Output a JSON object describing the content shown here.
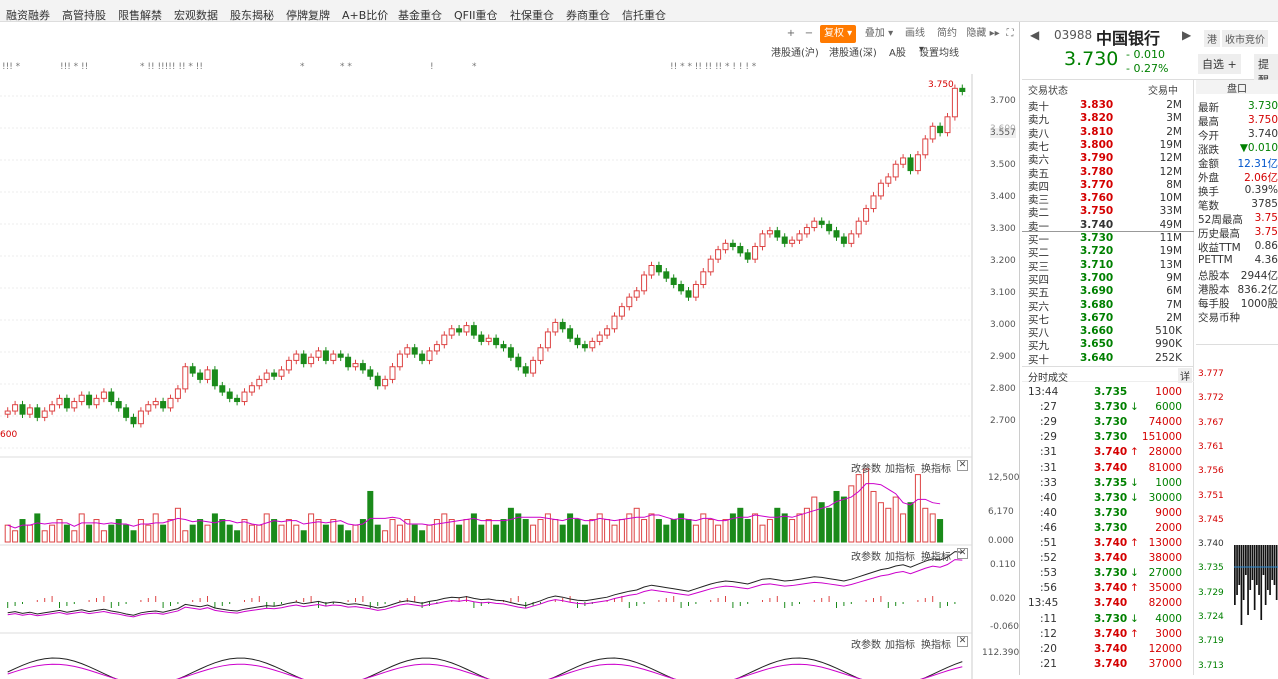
{
  "top_menu": {
    "row2": [
      "融资融券",
      "高管持股",
      "限售解禁",
      "宏观数据",
      "股东揭秘",
      "停牌复牌",
      "A+B比价",
      "基金重仓",
      "QFII重仓",
      "社保重仓",
      "券商重仓",
      "信托重仓"
    ]
  },
  "toolbar": {
    "plus": "+",
    "minus": "−",
    "fuquan": "复权",
    "overlay": "叠加",
    "draw": "画线",
    "brief": "简约",
    "hide": "隐藏"
  },
  "subbar": {
    "sh": "港股通(沪)",
    "sz": "港股通(深)",
    "a": "A股",
    "ma": "设置均线"
  },
  "panel_controls": {
    "params": "改参数",
    "add": "加指标",
    "switch": "换指标",
    "close": "✕"
  },
  "main_axis": {
    "labels": [
      "3.700",
      "3.600",
      "3.557",
      "3.500",
      "3.400",
      "3.300",
      "3.200",
      "3.100",
      "3.000",
      "2.900",
      "2.800",
      "2.700"
    ]
  },
  "price_marker": "3.750",
  "left_marker": "600",
  "vol_axis": [
    "12,500",
    "6,170",
    "0.000"
  ],
  "macd_axis": [
    "0.110",
    "0.020",
    "-0.060"
  ],
  "kdj_axis": [
    "112.390"
  ],
  "quote": {
    "code": "03988",
    "name": "中国银行",
    "badge_hk": "港",
    "closing": "收市竞价",
    "price": "3.730",
    "change": "- 0.010",
    "pct": "- 0.27%",
    "watch": "自选 +",
    "remind": "提醒"
  },
  "orderbook": {
    "header_left": "交易状态",
    "header_right": "交易中",
    "asks": [
      [
        "卖十",
        "3.830",
        "2M"
      ],
      [
        "卖九",
        "3.820",
        "3M"
      ],
      [
        "卖八",
        "3.810",
        "2M"
      ],
      [
        "卖七",
        "3.800",
        "19M"
      ],
      [
        "卖六",
        "3.790",
        "12M"
      ],
      [
        "卖五",
        "3.780",
        "12M"
      ],
      [
        "卖四",
        "3.770",
        "8M"
      ],
      [
        "卖三",
        "3.760",
        "10M"
      ],
      [
        "卖二",
        "3.750",
        "33M"
      ],
      [
        "卖一",
        "3.740",
        "49M"
      ]
    ],
    "bids": [
      [
        "买一",
        "3.730",
        "11M"
      ],
      [
        "买二",
        "3.720",
        "19M"
      ],
      [
        "买三",
        "3.710",
        "13M"
      ],
      [
        "买四",
        "3.700",
        "9M"
      ],
      [
        "买五",
        "3.690",
        "6M"
      ],
      [
        "买六",
        "3.680",
        "7M"
      ],
      [
        "买七",
        "3.670",
        "2M"
      ],
      [
        "买八",
        "3.660",
        "510K"
      ],
      [
        "买九",
        "3.650",
        "990K"
      ],
      [
        "买十",
        "3.640",
        "252K"
      ]
    ]
  },
  "stats": {
    "title": "盘口",
    "rows": [
      [
        "最新",
        "3.730"
      ],
      [
        "最高",
        "3.750"
      ],
      [
        "今开",
        "3.740"
      ],
      [
        "涨跌",
        "▼0.010"
      ],
      [
        "金额",
        "12.31亿"
      ],
      [
        "外盘",
        "2.06亿"
      ],
      [
        "换手",
        "0.39%"
      ],
      [
        "笔数",
        "3785"
      ],
      [
        "52周最高",
        "3.75"
      ],
      [
        "历史最高",
        "3.75"
      ],
      [
        "收益TTM",
        "0.86"
      ],
      [
        "PETTM",
        "4.36"
      ],
      [
        "总股本",
        "2944亿"
      ],
      [
        "港股本",
        "836.2亿"
      ],
      [
        "每手股",
        "1000股"
      ],
      [
        "交易币种",
        ""
      ]
    ]
  },
  "ticks": {
    "title": "分时成交",
    "detail": "详",
    "rows": [
      [
        "13:44",
        "3.735",
        "",
        "1000"
      ],
      [
        ":27",
        "3.730",
        "↓",
        "6000"
      ],
      [
        ":29",
        "3.730",
        "",
        "74000"
      ],
      [
        ":29",
        "3.730",
        "",
        "151000"
      ],
      [
        ":31",
        "3.740",
        "↑",
        "28000"
      ],
      [
        ":31",
        "3.740",
        "",
        "81000"
      ],
      [
        ":33",
        "3.735",
        "↓",
        "1000"
      ],
      [
        ":40",
        "3.730",
        "↓",
        "30000"
      ],
      [
        ":40",
        "3.730",
        "",
        "9000"
      ],
      [
        ":46",
        "3.730",
        "",
        "2000"
      ],
      [
        ":51",
        "3.740",
        "↑",
        "13000"
      ],
      [
        ":52",
        "3.740",
        "",
        "38000"
      ],
      [
        ":53",
        "3.730",
        "↓",
        "27000"
      ],
      [
        ":56",
        "3.740",
        "↑",
        "35000"
      ],
      [
        "13:45",
        "3.740",
        "",
        "82000"
      ],
      [
        ":11",
        "3.730",
        "↓",
        "4000"
      ],
      [
        ":12",
        "3.740",
        "↑",
        "3000"
      ],
      [
        ":20",
        "3.740",
        "",
        "12000"
      ],
      [
        ":21",
        "3.740",
        "",
        "37000"
      ]
    ]
  },
  "mini_axis": [
    "3.777",
    "3.772",
    "3.767",
    "3.761",
    "3.756",
    "3.751",
    "3.745",
    "3.740",
    "3.735",
    "3.729",
    "3.724",
    "3.719",
    "3.713"
  ],
  "chart_data": {
    "type": "candlestick",
    "y_range": [
      2.6,
      3.76
    ],
    "closes": [
      2.72,
      2.74,
      2.71,
      2.73,
      2.7,
      2.72,
      2.74,
      2.76,
      2.73,
      2.75,
      2.77,
      2.74,
      2.76,
      2.78,
      2.75,
      2.73,
      2.7,
      2.68,
      2.72,
      2.74,
      2.75,
      2.73,
      2.76,
      2.79,
      2.86,
      2.84,
      2.82,
      2.85,
      2.8,
      2.78,
      2.76,
      2.75,
      2.78,
      2.8,
      2.82,
      2.84,
      2.83,
      2.85,
      2.88,
      2.9,
      2.87,
      2.89,
      2.91,
      2.88,
      2.9,
      2.89,
      2.86,
      2.87,
      2.85,
      2.83,
      2.8,
      2.82,
      2.86,
      2.9,
      2.92,
      2.9,
      2.88,
      2.91,
      2.93,
      2.96,
      2.98,
      2.97,
      2.99,
      2.96,
      2.94,
      2.95,
      2.93,
      2.92,
      2.89,
      2.86,
      2.84,
      2.88,
      2.92,
      2.97,
      3.0,
      2.98,
      2.95,
      2.93,
      2.92,
      2.94,
      2.96,
      2.98,
      3.02,
      3.05,
      3.08,
      3.1,
      3.15,
      3.18,
      3.16,
      3.14,
      3.12,
      3.1,
      3.08,
      3.12,
      3.16,
      3.2,
      3.23,
      3.25,
      3.24,
      3.22,
      3.2,
      3.24,
      3.28,
      3.29,
      3.27,
      3.25,
      3.26,
      3.28,
      3.3,
      3.32,
      3.31,
      3.29,
      3.27,
      3.25,
      3.28,
      3.32,
      3.36,
      3.4,
      3.44,
      3.46,
      3.5,
      3.52,
      3.48,
      3.53,
      3.58,
      3.62,
      3.6,
      3.65,
      3.74,
      3.73
    ],
    "volumes": [
      3,
      2,
      4,
      3,
      5,
      2,
      3,
      4,
      3,
      2,
      5,
      3,
      4,
      2,
      3,
      4,
      3,
      2,
      4,
      3,
      5,
      3,
      4,
      6,
      2,
      3,
      4,
      3,
      5,
      4,
      3,
      2,
      4,
      3,
      3,
      5,
      4,
      3,
      4,
      3,
      2,
      5,
      4,
      3,
      4,
      3,
      2,
      3,
      4,
      9,
      3,
      2,
      4,
      3,
      4,
      3,
      2,
      3,
      4,
      5,
      4,
      3,
      4,
      5,
      3,
      4,
      3,
      4,
      6,
      5,
      4,
      3,
      4,
      5,
      4,
      3,
      5,
      4,
      3,
      4,
      5,
      4,
      3,
      4,
      5,
      6,
      4,
      5,
      4,
      3,
      4,
      5,
      4,
      3,
      5,
      4,
      3,
      4,
      5,
      6,
      4,
      5,
      3,
      4,
      6,
      5,
      4,
      5,
      6,
      8,
      7,
      6,
      9,
      8,
      10,
      12,
      13,
      9,
      7,
      6,
      8,
      5,
      7,
      12,
      6,
      5,
      4
    ]
  },
  "mini_chart_data": {
    "type": "bar",
    "values": [
      0.6,
      0.5,
      0.4,
      0.8,
      0.55,
      0.3,
      0.7,
      0.45,
      0.35,
      0.65,
      0.4,
      0.5,
      0.75,
      0.3,
      0.6,
      0.45,
      0.5,
      0.35,
      0.4,
      0.55
    ]
  }
}
